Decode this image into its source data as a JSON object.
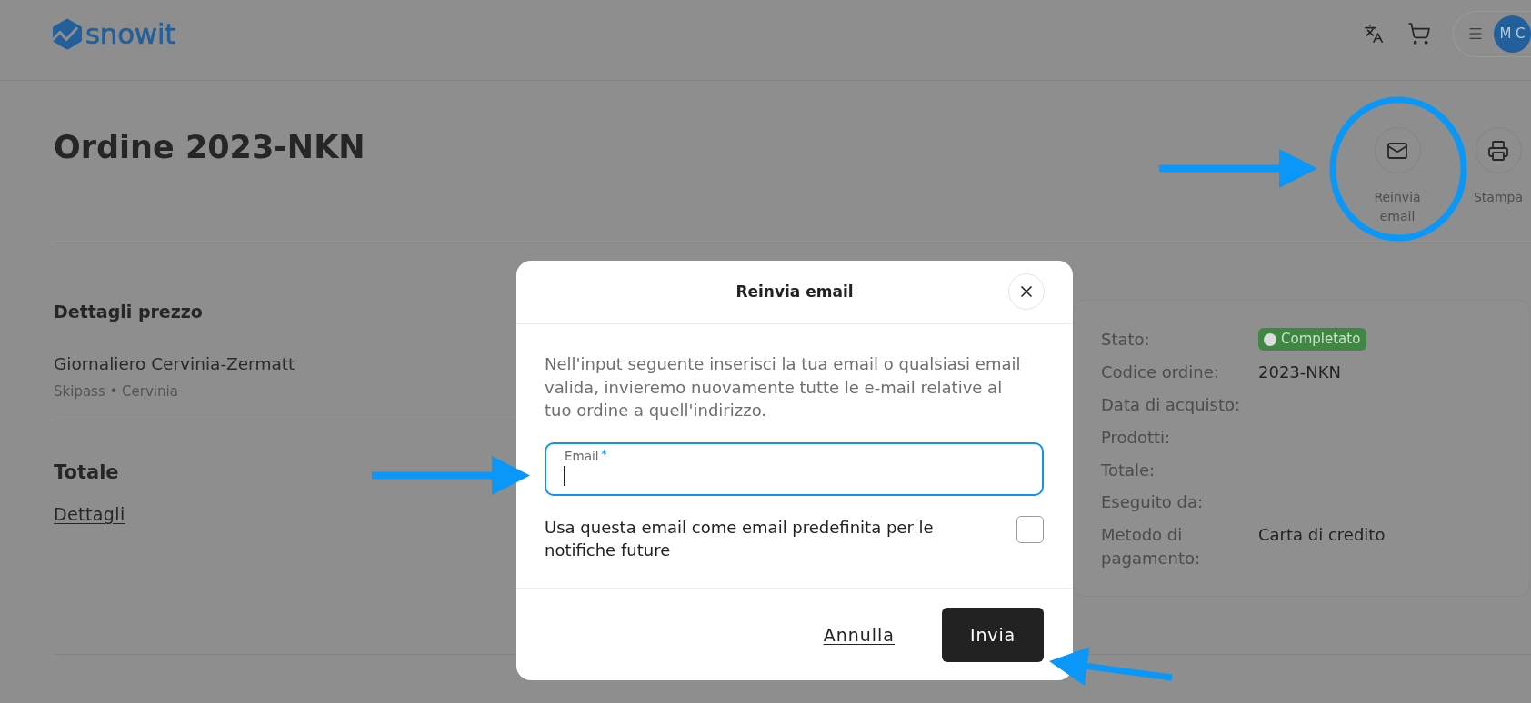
{
  "header": {
    "logo": "snowit",
    "avatar": "M C"
  },
  "order": {
    "title": "Ordine 2023-NKN",
    "actions": [
      {
        "kind": "email",
        "label": "Reinvia email",
        "annotated": true
      },
      {
        "kind": "print",
        "label": "Stampa"
      }
    ]
  },
  "price_details": {
    "title": "Dettagli prezzo",
    "items": [
      {
        "name": "Giornaliero Cervinia-Zermatt",
        "subtitle": "Skipass • Cervinia"
      }
    ]
  },
  "total": {
    "title": "Totale",
    "link": "Dettagli"
  },
  "summary": {
    "rows": [
      {
        "kind": "status",
        "label": "Stato:",
        "value": "Completato"
      },
      {
        "kind": "text",
        "label": "Codice ordine:",
        "value": "2023-NKN"
      },
      {
        "kind": "text",
        "label": "Data di acquisto:"
      },
      {
        "kind": "text",
        "label": "Prodotti:"
      },
      {
        "kind": "text",
        "label": "Totale:"
      },
      {
        "kind": "text",
        "label": "Eseguito da:"
      },
      {
        "kind": "text",
        "label": "Metodo di pagamento:",
        "value": "Carta di credito"
      }
    ]
  },
  "dialog": {
    "title": "Reinvia email",
    "text": "Nell'input seguente inserisci la tua email o qualsiasi email valida, invieremo nuovamente tutte le e-mail relative al tuo ordine a quell'indirizzo.",
    "email_field": {
      "label": "Email",
      "required_mark": "*",
      "focused": true,
      "annotated": true
    },
    "default_checkbox": {
      "label": "Usa questa email come email predefinita per le notifiche future",
      "checked": false
    },
    "buttons": [
      {
        "kind": "link",
        "label": "Annulla"
      },
      {
        "kind": "primary",
        "label": "Invia",
        "annotated": true
      }
    ]
  }
}
